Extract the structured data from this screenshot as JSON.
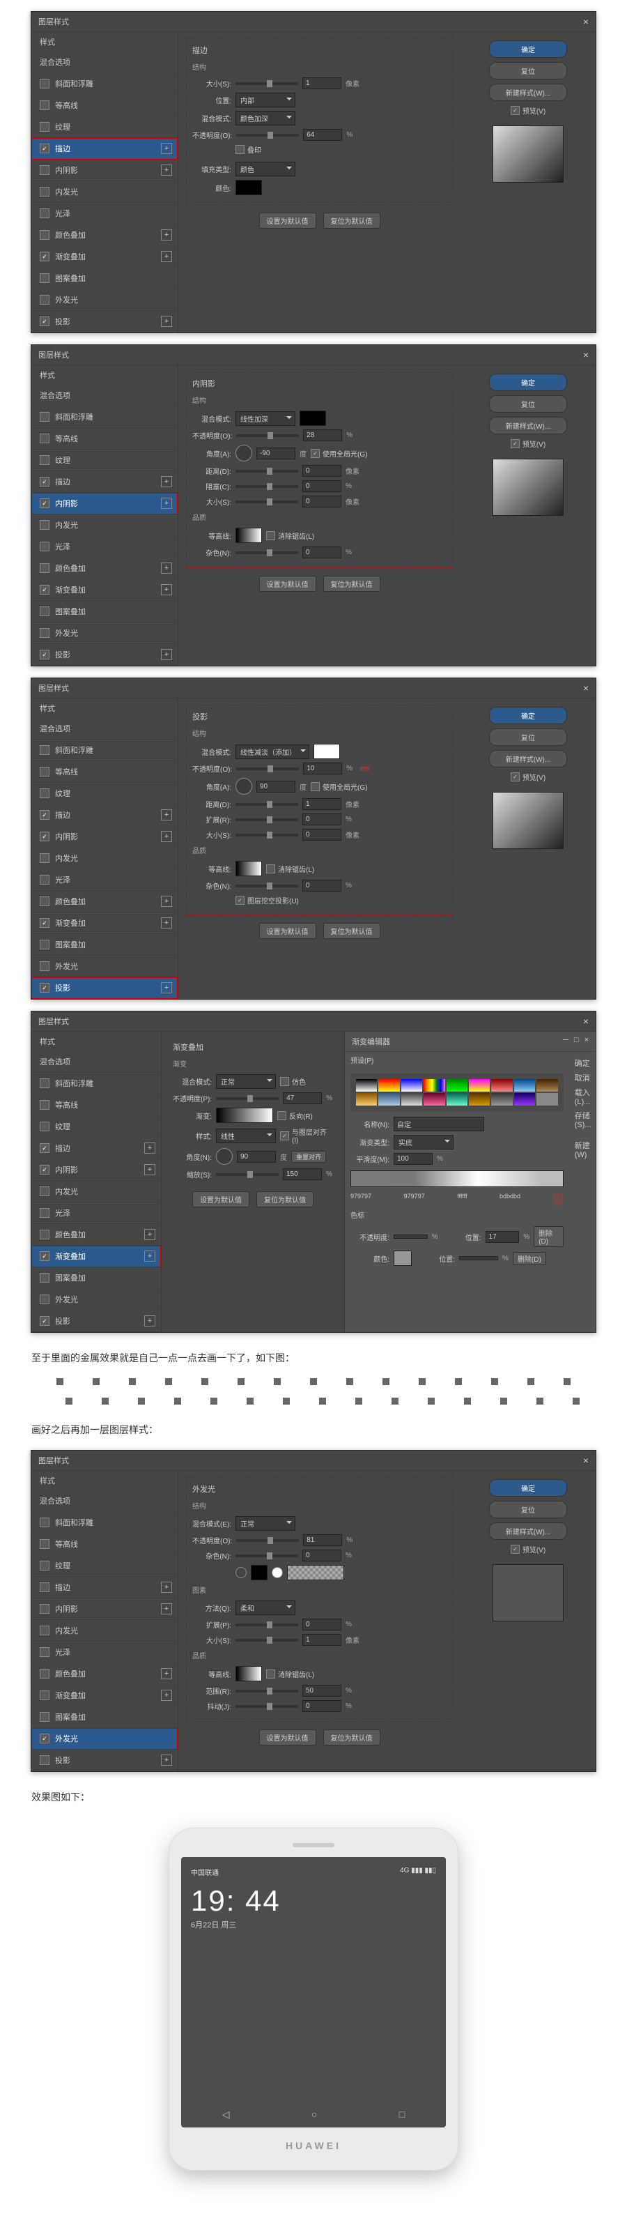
{
  "dialog_title": "图层样式",
  "close_x": "×",
  "sidebar_header": "样式",
  "buttons": {
    "ok": "确定",
    "reset": "复位",
    "new_style": "新建样式(W)...",
    "preview_cb": "预览(V)",
    "set_default": "设置为默认值",
    "reset_default": "复位为默认值"
  },
  "styles": {
    "blend": "混合选项",
    "bevel": "斜面和浮雕",
    "contour": "等高线",
    "texture": "纹理",
    "stroke": "描边",
    "inner_shadow": "内阴影",
    "inner_glow": "内发光",
    "satin": "光泽",
    "color_overlay": "颜色叠加",
    "grad_overlay": "渐变叠加",
    "pattern_overlay": "图案叠加",
    "outer_glow": "外发光",
    "drop_shadow": "投影"
  },
  "panel1": {
    "title": "描边",
    "structure": "结构",
    "size_l": "大小(S):",
    "size_v": "1",
    "px": "像素",
    "pos_l": "位置:",
    "pos_v": "内部",
    "blend_l": "混合模式:",
    "blend_v": "颜色加深",
    "opacity_l": "不透明度(O):",
    "opacity_v": "64",
    "pct": "%",
    "overprint": "叠印",
    "fill_l": "填充类型:",
    "fill_v": "颜色",
    "color_l": "颜色:"
  },
  "panel2": {
    "title": "内阴影",
    "structure": "结构",
    "blend_l": "混合模式:",
    "blend_v": "线性加深",
    "opacity_l": "不透明度(O):",
    "opacity_v": "28",
    "pct": "%",
    "angle_l": "角度(A):",
    "angle_v": "-90",
    "deg": "度",
    "global": "使用全局光(G)",
    "dist_l": "距离(D):",
    "dist_v": "0",
    "px": "像素",
    "choke_l": "阻塞(C):",
    "choke_v": "0",
    "size_l": "大小(S):",
    "size_v": "0",
    "quality": "品质",
    "contour_l": "等高线:",
    "anti": "消除锯齿(L)",
    "noise_l": "杂色(N):",
    "noise_v": "0"
  },
  "panel3": {
    "title": "投影",
    "structure": "结构",
    "blend_l": "混合模式:",
    "blend_v": "线性减淡（添加）",
    "opacity_l": "不透明度(O):",
    "opacity_v": "10",
    "pct": "%",
    "hex": "ffffff",
    "angle_l": "角度(A):",
    "angle_v": "90",
    "deg": "度",
    "global": "使用全局光(G)",
    "dist_l": "距离(D):",
    "dist_v": "1",
    "px": "像素",
    "spread_l": "扩展(R):",
    "spread_v": "0",
    "size_l": "大小(S):",
    "size_v": "0",
    "quality": "品质",
    "contour_l": "等高线:",
    "anti": "消除锯齿(L)",
    "noise_l": "杂色(N):",
    "noise_v": "0",
    "knockout": "图层挖空投影(U)"
  },
  "panel4": {
    "title": "渐变叠加",
    "grad": "渐变",
    "blend_l": "混合模式:",
    "blend_v": "正常",
    "dither": "仿色",
    "opacity_l": "不透明度(P):",
    "opacity_v": "47",
    "pct": "%",
    "grad_l": "渐变:",
    "reverse": "反向(R)",
    "style_l": "样式:",
    "style_v": "线性",
    "align": "与图层对齐(I)",
    "angle_l": "角度(N):",
    "angle_v": "90",
    "deg": "度",
    "reset_align": "重置对齐",
    "scale_l": "缩放(S):",
    "scale_v": "150"
  },
  "grad_editor": {
    "title": "渐变编辑器",
    "presets": "预设(P)",
    "ok": "确定",
    "cancel": "取消",
    "load": "载入(L)...",
    "save": "存储(S)...",
    "new": "新建(W)",
    "name_l": "名称(N):",
    "name_v": "自定",
    "type_l": "渐变类型:",
    "type_v": "实底",
    "smooth_l": "平滑度(M):",
    "smooth_v": "100",
    "pct": "%",
    "stops_section": "色标",
    "stop1_c": "979797",
    "stop2_c": "bdbdbd",
    "stop3_c": "ffffff",
    "stop4_c": "979797",
    "opacity_l": "不透明度:",
    "opacity_v": "",
    "pos_l": "位置:",
    "pos_v": "17",
    "del": "删除(D)",
    "color_l": "颜色:",
    "pos2_l": "位置:",
    "pos2_v": "",
    "del2": "删除(D)"
  },
  "panel5": {
    "title": "外发光",
    "structure": "结构",
    "blend_l": "混合模式(E):",
    "blend_v": "正常",
    "opacity_l": "不透明度(O):",
    "opacity_v": "81",
    "pct": "%",
    "noise_l": "杂色(N):",
    "noise_v": "0",
    "element": "图素",
    "tech_l": "方法(Q):",
    "tech_v": "柔和",
    "spread_l": "扩展(P):",
    "spread_v": "0",
    "size_l": "大小(S):",
    "size_v": "1",
    "px": "像素",
    "quality": "品质",
    "contour_l": "等高线:",
    "anti": "消除锯齿(L)",
    "range_l": "范围(R):",
    "range_v": "50",
    "jitter_l": "抖动(J):",
    "jitter_v": "0"
  },
  "text1": "至于里面的金属效果就是自己一点一点去画一下了，如下图：",
  "text2": "画好之后再加一层图层样式：",
  "text3": "效果图如下：",
  "phone": {
    "carrier": "中国联通",
    "time": "19: 44",
    "date": "6月22日 周三",
    "brand": "HUAWEI",
    "signal": "▮▮▮",
    "net": "4G",
    "batt": "▮▮▯"
  }
}
